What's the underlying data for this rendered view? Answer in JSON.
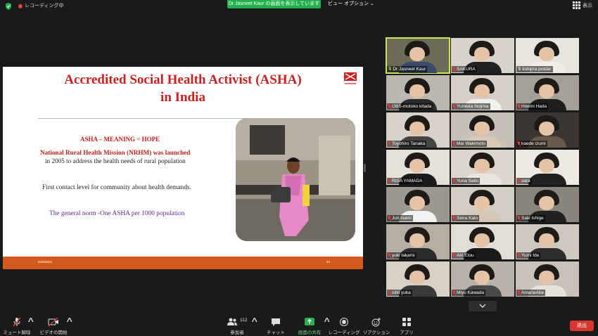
{
  "topbar": {
    "recording_label": "レコーディング中",
    "share_banner": "Dr Jasneet Kaur の画面を表示しています",
    "view_options": "ビュー オプション ⌄",
    "display_label": "表示"
  },
  "slide": {
    "title_line1": "Accredited Social Health Activist (ASHA)",
    "title_line2": "in India",
    "meaning": "ASHA – MEANING = HOPE",
    "nrhm_line1": "National Rural Health Mission (NRHM) was launched",
    "nrhm_line2": "in 2005 to address the health needs of rural population",
    "contact": "First contact level for community about health demands.",
    "norm": "The general norm -One ASHA per 1000 population",
    "footer_date": "6/26/2022",
    "footer_page": "24",
    "colors": {
      "title": "#d01f1f",
      "norm": "#5a2d8c",
      "footer": "#d35a1c"
    }
  },
  "participants": [
    {
      "name": "Dr Jasneet Kaur",
      "muted": false,
      "active": true
    },
    {
      "name": "SAKURA",
      "muted": true
    },
    {
      "name": "kshipra potdar",
      "muted": false
    },
    {
      "name": "OBS-motoko kitada",
      "muted": true
    },
    {
      "name": "Yumeka Nojima",
      "muted": true
    },
    {
      "name": "Hoemi Hada",
      "muted": true
    },
    {
      "name": "Toyohiro Tanaka",
      "muted": true
    },
    {
      "name": "Mai Wakimoto",
      "muted": true
    },
    {
      "name": "kaede izumi",
      "muted": true
    },
    {
      "name": "RISA YAMADA",
      "muted": true
    },
    {
      "name": "Yuna Saito",
      "muted": true
    },
    {
      "name": "sara",
      "muted": true
    },
    {
      "name": "Juri Isami",
      "muted": true
    },
    {
      "name": "Seira Kato",
      "muted": true
    },
    {
      "name": "Saki Ishige",
      "muted": true
    },
    {
      "name": "yuki takami",
      "muted": true
    },
    {
      "name": "Airi Etou",
      "muted": true
    },
    {
      "name": "Yumi Ide",
      "muted": true
    },
    {
      "name": "ishii yuka",
      "muted": true
    },
    {
      "name": "Miyu Kawada",
      "muted": true
    },
    {
      "name": "AmaneAbe",
      "muted": true
    }
  ],
  "toolbar": {
    "unmute": "ミュート解除",
    "start_video": "ビデオの開始",
    "participants_count": "112",
    "participants": "参加者",
    "chat": "チャット",
    "share_screen": "画面の共有",
    "record": "レコーディング",
    "reactions": "リアクション",
    "apps": "アプリ",
    "exit": "退出",
    "share_color": "#22b14c",
    "exit_color": "#d7372f"
  }
}
